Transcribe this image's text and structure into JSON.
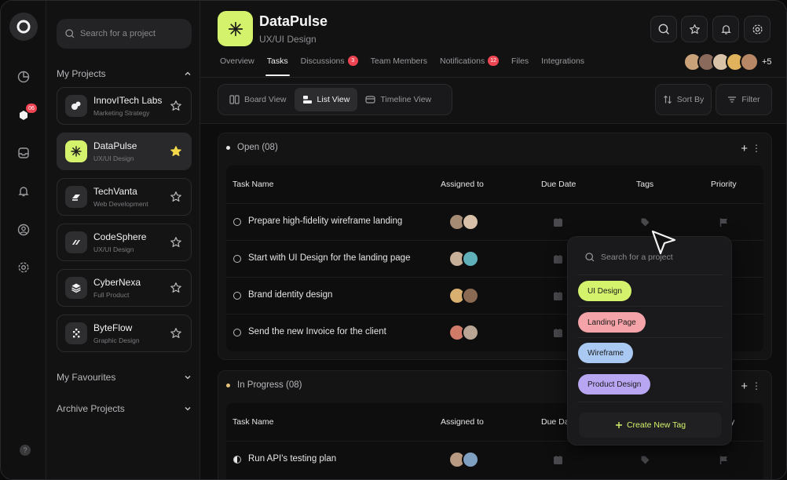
{
  "sidebar": {
    "search_placeholder": "Search for a project",
    "my_projects_label": "My Projects",
    "projects": [
      {
        "name": "InnovITech Labs",
        "sub": "Marketing Strategy",
        "starred": false
      },
      {
        "name": "DataPulse",
        "sub": "UX/UI Design",
        "starred": true
      },
      {
        "name": "TechVanta",
        "sub": "Web Development",
        "starred": false
      },
      {
        "name": "CodeSphere",
        "sub": "UX/UI Design",
        "starred": false
      },
      {
        "name": "CyberNexa",
        "sub": "Full Product",
        "starred": false
      },
      {
        "name": "ByteFlow",
        "sub": "Graphic Design",
        "starred": false
      }
    ],
    "favourites_label": "My Favourites",
    "archive_label": "Archive Projects"
  },
  "rail": {
    "badge": "06",
    "help": "?"
  },
  "header": {
    "title": "DataPulse",
    "subtitle": "UX/UI Design",
    "tabs": [
      {
        "label": "Overview",
        "badge": null
      },
      {
        "label": "Tasks",
        "badge": null
      },
      {
        "label": "Discussions",
        "badge": "3"
      },
      {
        "label": "Team Members",
        "badge": null
      },
      {
        "label": "Notifications",
        "badge": "12"
      },
      {
        "label": "Files",
        "badge": null
      },
      {
        "label": "Integrations",
        "badge": null
      }
    ],
    "active_tab": "Tasks",
    "members_more": "+5"
  },
  "toolbar": {
    "views": [
      "Board View",
      "List View",
      "Timeline View"
    ],
    "active_view": "List View",
    "sort_label": "Sort By",
    "filter_label": "Filter"
  },
  "table_headers": {
    "task": "Task Name",
    "assigned": "Assigned to",
    "due": "Due Date",
    "due_clipped": "Due Da",
    "tags": "Tags",
    "priority": "Priority",
    "priority_clipped": "y"
  },
  "groups": {
    "open": {
      "title": "Open (08)",
      "tasks": [
        "Prepare high-fidelity wireframe landing",
        "Start with UI Design for the landing page",
        "Brand identity design",
        "Send the new Invoice for the client"
      ]
    },
    "in_progress": {
      "title": "In Progress (08)",
      "tasks": [
        "Run API's testing plan"
      ]
    }
  },
  "tag_dropdown": {
    "search_placeholder": "Search for a project",
    "tags": [
      {
        "label": "UI Design",
        "color": "#d4f26c"
      },
      {
        "label": "Landing Page",
        "color": "#f4a3a8"
      },
      {
        "label": "Wireframe",
        "color": "#a9c9f2"
      },
      {
        "label": "Product Design",
        "color": "#b9a6f2"
      }
    ],
    "create_label": "Create New Tag"
  },
  "colors": {
    "accent": "#d4f26c",
    "badge": "#ef4452"
  }
}
